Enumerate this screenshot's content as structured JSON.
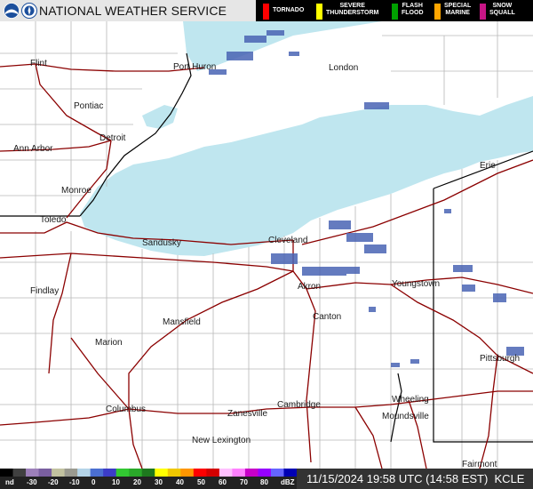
{
  "header": {
    "title": "NATIONAL WEATHER SERVICE",
    "warnings": [
      {
        "label": "TORNADO",
        "color": "#ff0000"
      },
      {
        "label": "SEVERE\nTHUNDERSTORM",
        "color": "#ffff00"
      },
      {
        "label": "FLASH\nFLOOD",
        "color": "#00a000"
      },
      {
        "label": "SPECIAL\nMARINE",
        "color": "#ffa500"
      },
      {
        "label": "SNOW\nSQUALL",
        "color": "#c71585"
      }
    ]
  },
  "cities": {
    "flint": "Flint",
    "port_huron": "Port Huron",
    "london": "London",
    "pontiac": "Pontiac",
    "detroit": "Detroit",
    "ann_arbor": "Ann Arbor",
    "monroe": "Monroe",
    "toledo": "Toledo",
    "sandusky": "Sandusky",
    "cleveland": "Cleveland",
    "erie": "Erie",
    "findlay": "Findlay",
    "akron": "Akron",
    "youngstown": "Youngstown",
    "mansfield": "Mansfield",
    "canton": "Canton",
    "marion": "Marion",
    "pittsburgh": "Pittsburgh",
    "columbus": "Columbus",
    "zanesville": "Zanesville",
    "cambridge": "Cambridge",
    "wheeling": "Wheeling",
    "moundsville": "Moundsville",
    "new_lexington": "New Lexington",
    "fairmont": "Fairmont"
  },
  "legend": {
    "labels": [
      "nd",
      "-30",
      "-20",
      "-10",
      "0",
      "10",
      "20",
      "30",
      "40",
      "50",
      "60",
      "70",
      "80",
      "dBZ"
    ],
    "colors": [
      "#000000",
      "#404040",
      "#9c7fb9",
      "#7a5fa0",
      "#c2c2a0",
      "#9a9a90",
      "#b4d4e8",
      "#4b6fd1",
      "#3c3cc8",
      "#32c832",
      "#2aa82a",
      "#1e781e",
      "#ffff00",
      "#f0c800",
      "#ff9600",
      "#ff0000",
      "#d40000",
      "#ffc0ff",
      "#ff80ff",
      "#c800c8",
      "#9600ff",
      "#6464ff",
      "#0000b4"
    ]
  },
  "footer": {
    "timestamp": "11/15/2024 19:58 UTC (14:58 EST)",
    "station": "KCLE"
  },
  "colors": {
    "water": "#bfe6ef",
    "state_border": "#000000",
    "county_border": "#b8b8b8",
    "highway": "#8b0000",
    "radar_echo": "#4a64b4"
  }
}
